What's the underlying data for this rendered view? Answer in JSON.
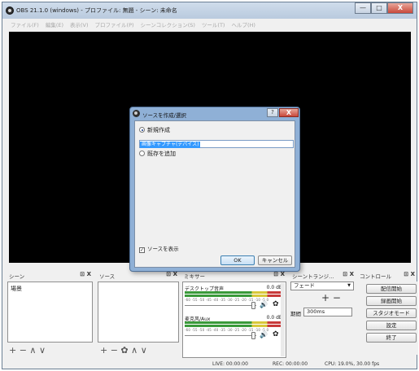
{
  "window": {
    "title": "OBS 21.1.0 (windows) - プロファイル: 無題 - シーン: 未命名",
    "caption_min": "—",
    "caption_max": "□",
    "caption_close": "X"
  },
  "menu": [
    "ファイル(F)",
    "編集(E)",
    "表示(V)",
    "プロファイル(P)",
    "シーンコレクション(S)",
    "ツール(T)",
    "ヘルプ(H)"
  ],
  "docks": {
    "scenes": {
      "title": "シーン",
      "buttons": "⊡ X",
      "items": [
        "場景"
      ]
    },
    "sources": {
      "title": "ソース",
      "buttons": "⊡ X"
    },
    "mixer": {
      "title": "ミキサー",
      "buttons": "⊡ X"
    },
    "transitions": {
      "title": "シーントランジ…",
      "buttons": "⊡ X"
    },
    "controls": {
      "title": "コントロール",
      "buttons": "⊡ X"
    }
  },
  "toolbars": {
    "scenes": "+ − ∧ ∨",
    "sources": "+ − ✿ ∧ ∨"
  },
  "mixer": {
    "tracks": [
      {
        "name": "デスクトップ音声",
        "db": "0.0 dB",
        "ticks": "-60 -55 -50 -45 -40 -35 -30 -25 -20 -15 -10 -5 0"
      },
      {
        "name": "麦克风/Aux",
        "db": "0.0 dB",
        "ticks": "-60 -55 -50 -45 -40 -35 -30 -25 -20 -15 -10 -5 0"
      }
    ],
    "speaker_icon": "speaker-icon",
    "gear_icon": "gear-icon"
  },
  "transitions": {
    "selected": "フェード",
    "add_remove": "+ −",
    "duration_label": "期間",
    "duration_value": "300ms"
  },
  "controls": {
    "buttons": [
      "配信開始",
      "録画開始",
      "スタジオモード",
      "設定",
      "終了"
    ]
  },
  "status": {
    "live": "LIVE: 00:00:00",
    "rec": "REC: 00:00:00",
    "cpu": "CPU: 19.0%, 30.00 fps"
  },
  "dialog": {
    "title": "ソースを作成/選択",
    "help": "?",
    "close": "X",
    "create_new_label": "新規作成",
    "name_value": "画像キャプチャ(デバイス)",
    "add_existing_label": "既存を追加",
    "visible_label": "ソースを表示",
    "ok_label": "OK",
    "cancel_label": "キャンセル"
  }
}
